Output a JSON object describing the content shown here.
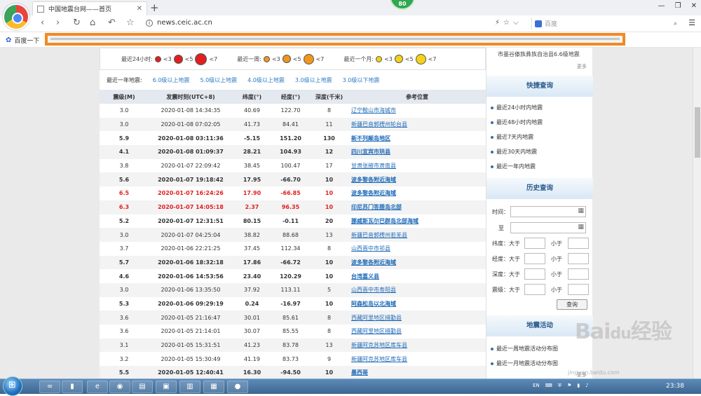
{
  "browser": {
    "tab_title": "中国地震台网——首页",
    "new_tab": "+",
    "badge": "80",
    "url": "news.ceic.ac.cn",
    "search_placeholder": "百度",
    "bookmark": "百度一下",
    "win_min": "—",
    "win_max": "❐",
    "win_close": "✕"
  },
  "legend": {
    "day": "最近24小时:",
    "week": "最近一周:",
    "month": "最近一个月:",
    "s1": "<3",
    "s2": "<5",
    "s3": "<7",
    "colors": {
      "day": "#e02020",
      "week": "#f0961e",
      "month": "#f5d21a"
    }
  },
  "filter": {
    "lead": "最近一年地震:",
    "links": [
      "6.0级以上地震",
      "5.0级以上地震",
      "4.0级以上地震",
      "3.0级以上地震",
      "3.0级以下地震"
    ]
  },
  "table": {
    "headers": [
      "震级(M)",
      "发震时刻(UTC+8)",
      "纬度(°)",
      "经度(°)",
      "深度(千米)",
      "参考位置"
    ],
    "rows": [
      [
        "3.0",
        "2020-01-08 14:34:35",
        "40.69",
        "122.70",
        "8",
        "辽宁鞍山市海城市"
      ],
      [
        "3.0",
        "2020-01-08 07:02:05",
        "41.73",
        "84.41",
        "11",
        "新疆巴音郭楞州轮台县"
      ],
      [
        "5.9",
        "2020-01-08 03:11:36",
        "-5.15",
        "151.20",
        "130",
        "新不列颠岛地区"
      ],
      [
        "4.1",
        "2020-01-08 01:09:37",
        "28.21",
        "104.93",
        "12",
        "四川宜宾市珙县"
      ],
      [
        "3.8",
        "2020-01-07 22:09:42",
        "38.45",
        "100.47",
        "17",
        "甘肃张掖市肃南县"
      ],
      [
        "5.6",
        "2020-01-07 19:18:42",
        "17.95",
        "-66.70",
        "10",
        "波多黎各附近海域"
      ],
      [
        "6.5",
        "2020-01-07 16:24:26",
        "17.90",
        "-66.85",
        "10",
        "波多黎各附近海域"
      ],
      [
        "6.3",
        "2020-01-07 14:05:18",
        "2.37",
        "96.35",
        "10",
        "印尼苏门答腊岛北部"
      ],
      [
        "5.2",
        "2020-01-07 12:31:51",
        "80.15",
        "-0.11",
        "20",
        "挪威斯瓦尔巴群岛北部海域"
      ],
      [
        "3.0",
        "2020-01-07 04:25:04",
        "38.82",
        "88.68",
        "13",
        "新疆巴音郭楞州若羌县"
      ],
      [
        "3.7",
        "2020-01-06 22:21:25",
        "37.45",
        "112.34",
        "8",
        "山西晋中市祁县"
      ],
      [
        "5.7",
        "2020-01-06 18:32:18",
        "17.86",
        "-66.72",
        "10",
        "波多黎各附近海域"
      ],
      [
        "4.6",
        "2020-01-06 14:53:56",
        "23.40",
        "120.29",
        "10",
        "台湾嘉义县"
      ],
      [
        "3.0",
        "2020-01-06 13:35:50",
        "37.92",
        "113.11",
        "5",
        "山西晋中市寿阳县"
      ],
      [
        "5.3",
        "2020-01-06 09:29:19",
        "0.24",
        "-16.97",
        "10",
        "阿森松岛以北海域"
      ],
      [
        "3.6",
        "2020-01-05 21:16:47",
        "30.01",
        "85.61",
        "8",
        "西藏阿里地区措勤县"
      ],
      [
        "3.6",
        "2020-01-05 21:14:01",
        "30.07",
        "85.55",
        "8",
        "西藏阿里地区措勤县"
      ],
      [
        "3.1",
        "2020-01-05 15:31:51",
        "41.23",
        "83.78",
        "13",
        "新疆阿克苏地区库车县"
      ],
      [
        "3.2",
        "2020-01-05 15:30:49",
        "41.19",
        "83.73",
        "9",
        "新疆阿克苏地区库车县"
      ],
      [
        "5.5",
        "2020-01-05 12:40:41",
        "16.30",
        "-94.50",
        "10",
        "墨西哥"
      ]
    ]
  },
  "sidebar": {
    "news_item": "市墨谷傣族彝族自治县6.6级地震",
    "more": "更多",
    "quick_title": "快捷查询",
    "quick_links": [
      "最近24小时内地震",
      "最近48小时内地震",
      "最近7天内地震",
      "最近30天内地震",
      "最近一年内地震"
    ],
    "history_title": "历史查询",
    "time_label": "时间：",
    "to_label": "至",
    "lat_label": "纬度：大于",
    "lon_label": "经度：大于",
    "depth_label": "深度：大于",
    "mag_label": "震级：大于",
    "lt_label": "小于",
    "query_btn": "查询",
    "activity_title": "地震活动",
    "activity_links": [
      "最近一周地震活动分布图",
      "最近一月地震活动分布图"
    ],
    "more2": "更多"
  },
  "taskbar": {
    "lang": "EN",
    "clock": "23:38"
  },
  "watermark": {
    "main": "Bai",
    "du": "du",
    "tail": "经验",
    "sub": "jingyan.baidu.com"
  }
}
